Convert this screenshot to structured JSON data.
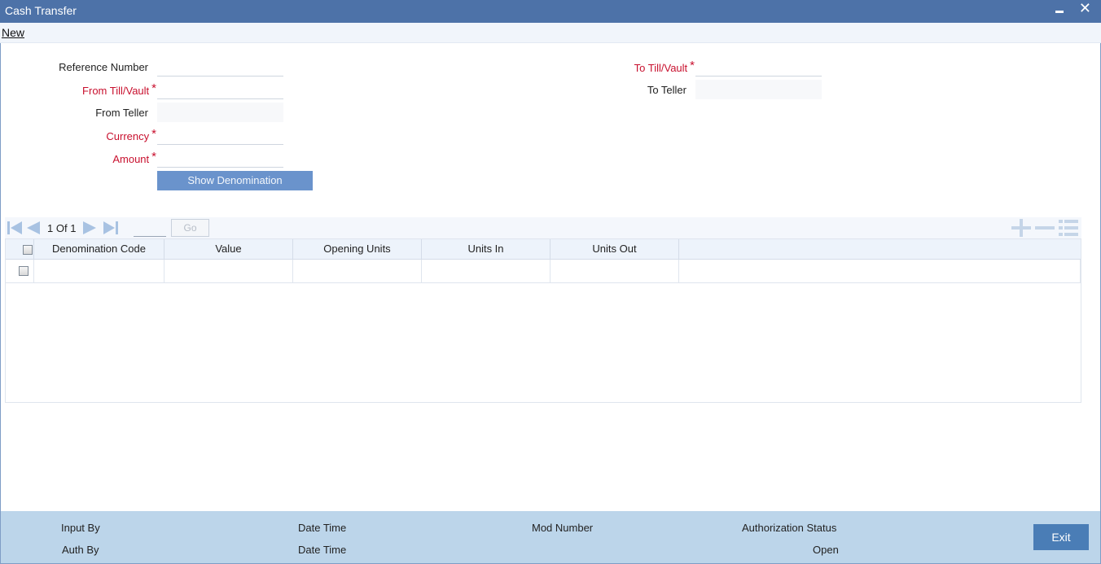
{
  "window": {
    "title": "Cash Transfer"
  },
  "menu": {
    "new_label": "New"
  },
  "form": {
    "reference_number_label": "Reference Number",
    "from_till_label": "From Till/Vault",
    "from_teller_label": "From Teller",
    "currency_label": "Currency",
    "amount_label": "Amount",
    "to_till_label": "To Till/Vault",
    "to_teller_label": "To Teller",
    "required_mark": "*",
    "show_denomination_label": "Show Denomination"
  },
  "grid": {
    "pager": {
      "current": "1",
      "of_label": "Of",
      "total": "1",
      "go_label": "Go"
    },
    "columns": [
      "Denomination Code",
      "Value",
      "Opening Units",
      "Units In",
      "Units Out"
    ]
  },
  "footer": {
    "input_by_label": "Input By",
    "auth_by_label": "Auth By",
    "date_time_label_1": "Date Time",
    "date_time_label_2": "Date Time",
    "mod_number_label": "Mod Number",
    "authorization_status_label": "Authorization Status",
    "status_value": "Open",
    "exit_label": "Exit"
  },
  "colors": {
    "titlebar": "#4d72a8",
    "required": "#c8102e",
    "button": "#6a93cc",
    "footer": "#bcd5ea",
    "exit": "#4a7db6"
  }
}
